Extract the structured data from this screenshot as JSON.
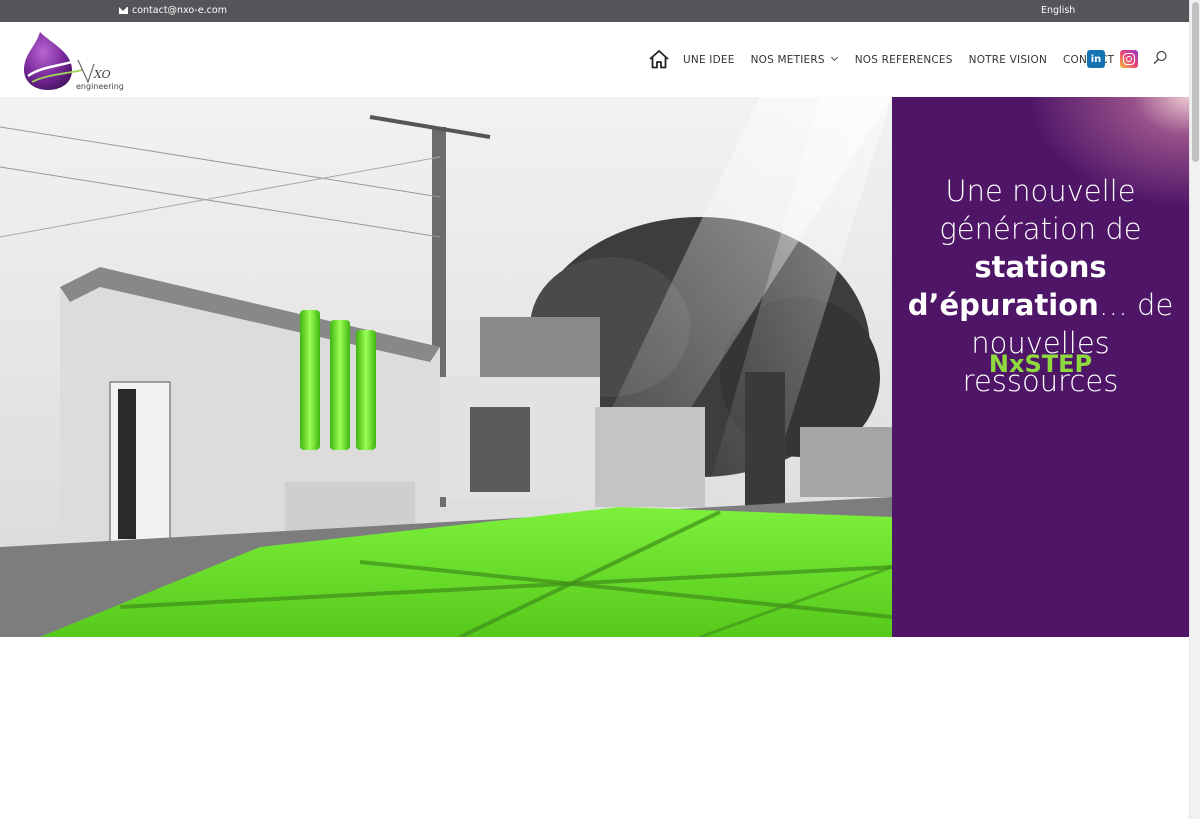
{
  "topbar": {
    "email": "contact@nxo-e.com",
    "email_icon": "envelope-icon",
    "language": "English"
  },
  "header": {
    "logo": {
      "brand": "XO",
      "tagline": "engineering"
    },
    "nav": {
      "home_icon": "home-icon",
      "items": [
        {
          "label": "UNE IDEE"
        },
        {
          "label": "NOS METIERS",
          "has_dropdown": true
        },
        {
          "label": "NOS REFERENCES"
        },
        {
          "label": "NOTRE VISION"
        },
        {
          "label": "CONTACT"
        }
      ]
    },
    "social": {
      "linkedin": "in",
      "linkedin_icon": "linkedin-icon",
      "instagram_icon": "instagram-icon"
    },
    "search_icon": "search-icon"
  },
  "hero": {
    "headline_line1": "Une nouvelle",
    "headline_line2_pre": "génération de ",
    "headline_line2_bold": "stations",
    "headline_line3_bold": "d’épuration",
    "headline_line3_post": "… de",
    "headline_line4": "nouvelles ressources",
    "brand": "NxSTEP"
  },
  "colors": {
    "topbar_bg": "#555559",
    "panel_bg": "#4f1668",
    "brand_green": "#8ed93d",
    "pool_green": "#6fe62a"
  }
}
